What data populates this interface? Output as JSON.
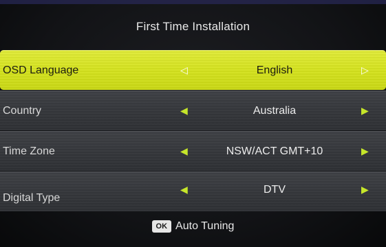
{
  "header": {
    "title": "First Time Installation"
  },
  "rows": [
    {
      "label": "OSD Language",
      "value": "English",
      "selected": true,
      "left_arrow_icon": "left-triangle-outline",
      "right_arrow_icon": "right-triangle-outline"
    },
    {
      "label": "Country",
      "value": "Australia",
      "selected": false,
      "left_arrow_icon": "left-triangle",
      "right_arrow_icon": "right-triangle"
    },
    {
      "label": "Time Zone",
      "value": "NSW/ACT GMT+10",
      "selected": false,
      "left_arrow_icon": "left-triangle",
      "right_arrow_icon": "right-triangle"
    },
    {
      "label": "Digital Type",
      "value": "DTV",
      "selected": false,
      "left_arrow_icon": "left-triangle",
      "right_arrow_icon": "right-triangle"
    }
  ],
  "footer": {
    "ok_label": "OK",
    "action_label": "Auto Tuning"
  },
  "colors": {
    "highlight": "#d4e21e",
    "arrow_accent": "#c6e62a",
    "row_background": "#36383c",
    "screen_background": "#121316"
  }
}
